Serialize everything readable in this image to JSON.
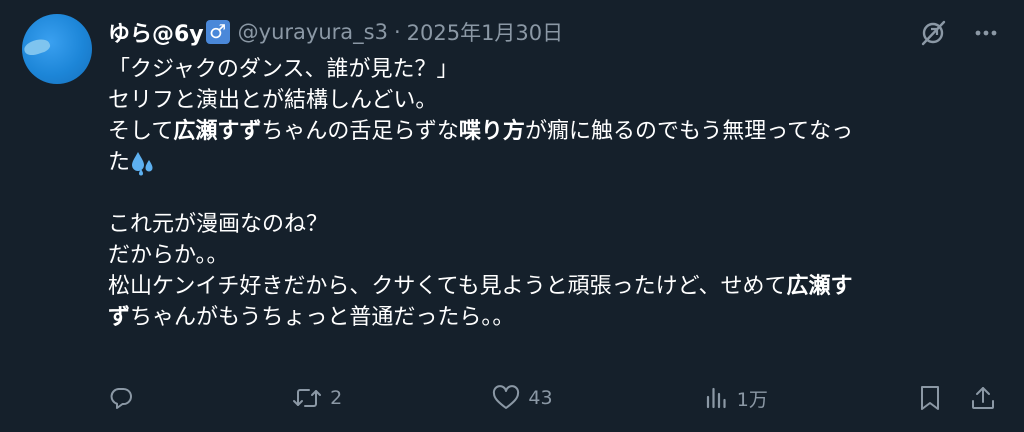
{
  "tweet": {
    "display_name": "ゆら@6y",
    "badge": "♂",
    "handle": "@yurayura_s3",
    "separator": "·",
    "date": "2025年1月30日",
    "lines": {
      "l1": "「クジャクのダンス、誰が見た？」",
      "l2": "セリフと演出とが結構しんどい。",
      "l3a": "そして",
      "l3b": "広瀬すず",
      "l3c": "ちゃんの舌足らずな",
      "l3d": "喋り方",
      "l3e": "が癇に触るのでもう無理ってなっ",
      "l4": "た",
      "l5": "これ元が漫画なのね？",
      "l6": "だからか。。",
      "l7a": "松山ケンイチ好きだから、クサくても見ようと頑張ったけど、せめて",
      "l7b": "広瀬す",
      "l8a": "ず",
      "l8b": "ちゃんがもうちょっと普通だったら。。"
    }
  },
  "metrics": {
    "replies": "",
    "reposts": "2",
    "likes": "43",
    "views": "1万"
  },
  "icons": {
    "grok": "grok-icon",
    "more": "more-icon",
    "reply": "reply-icon",
    "repost": "repost-icon",
    "like": "heart-icon",
    "views": "views-icon",
    "bookmark": "bookmark-icon",
    "share": "share-icon",
    "emoji": "sweat-droplets-emoji"
  },
  "colors": {
    "background": "#15202b",
    "text": "#ffffff",
    "muted": "#8b98a5",
    "badge": "#4a88d9",
    "avatar": "#1d86d8"
  }
}
